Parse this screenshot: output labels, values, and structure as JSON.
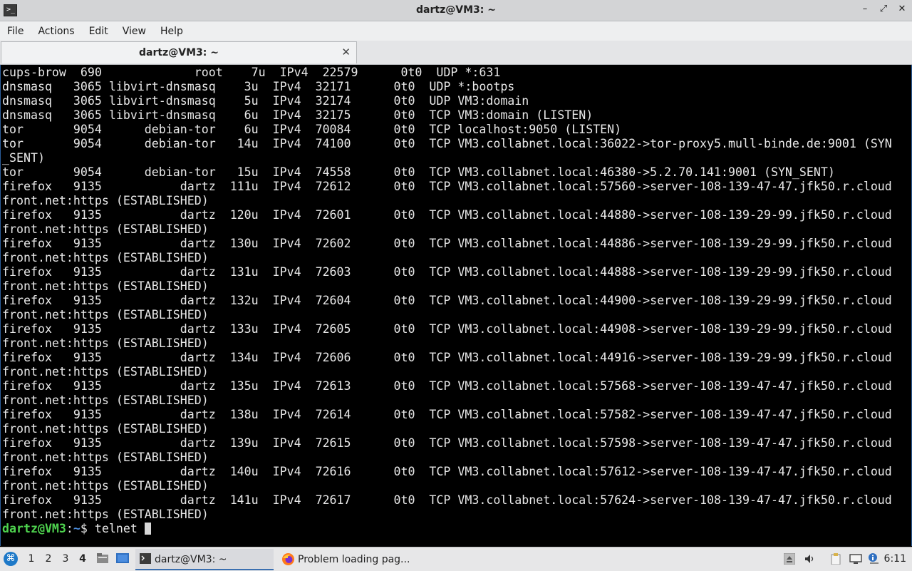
{
  "window": {
    "title": "dartz@VM3: ~",
    "app_icon_glyph": ">_",
    "controls": {
      "minimize": "–",
      "maximize": "⤢",
      "close": "✕"
    }
  },
  "menu": [
    "File",
    "Actions",
    "Edit",
    "View",
    "Help"
  ],
  "tab": {
    "label": "dartz@VM3: ~",
    "close": "✕"
  },
  "terminal": {
    "lines": [
      "cups-brow  690             root    7u  IPv4  22579      0t0  UDP *:631",
      "dnsmasq   3065 libvirt-dnsmasq    3u  IPv4  32171      0t0  UDP *:bootps",
      "dnsmasq   3065 libvirt-dnsmasq    5u  IPv4  32174      0t0  UDP VM3:domain",
      "dnsmasq   3065 libvirt-dnsmasq    6u  IPv4  32175      0t0  TCP VM3:domain (LISTEN)",
      "tor       9054      debian-tor    6u  IPv4  70084      0t0  TCP localhost:9050 (LISTEN)",
      "tor       9054      debian-tor   14u  IPv4  74100      0t0  TCP VM3.collabnet.local:36022->tor-proxy5.mull-binde.de:9001 (SYN",
      "_SENT)",
      "tor       9054      debian-tor   15u  IPv4  74558      0t0  TCP VM3.collabnet.local:46380->5.2.70.141:9001 (SYN_SENT)",
      "firefox   9135           dartz  111u  IPv4  72612      0t0  TCP VM3.collabnet.local:57560->server-108-139-47-47.jfk50.r.cloud",
      "front.net:https (ESTABLISHED)",
      "firefox   9135           dartz  120u  IPv4  72601      0t0  TCP VM3.collabnet.local:44880->server-108-139-29-99.jfk50.r.cloud",
      "front.net:https (ESTABLISHED)",
      "firefox   9135           dartz  130u  IPv4  72602      0t0  TCP VM3.collabnet.local:44886->server-108-139-29-99.jfk50.r.cloud",
      "front.net:https (ESTABLISHED)",
      "firefox   9135           dartz  131u  IPv4  72603      0t0  TCP VM3.collabnet.local:44888->server-108-139-29-99.jfk50.r.cloud",
      "front.net:https (ESTABLISHED)",
      "firefox   9135           dartz  132u  IPv4  72604      0t0  TCP VM3.collabnet.local:44900->server-108-139-29-99.jfk50.r.cloud",
      "front.net:https (ESTABLISHED)",
      "firefox   9135           dartz  133u  IPv4  72605      0t0  TCP VM3.collabnet.local:44908->server-108-139-29-99.jfk50.r.cloud",
      "front.net:https (ESTABLISHED)",
      "firefox   9135           dartz  134u  IPv4  72606      0t0  TCP VM3.collabnet.local:44916->server-108-139-29-99.jfk50.r.cloud",
      "front.net:https (ESTABLISHED)",
      "firefox   9135           dartz  135u  IPv4  72613      0t0  TCP VM3.collabnet.local:57568->server-108-139-47-47.jfk50.r.cloud",
      "front.net:https (ESTABLISHED)",
      "firefox   9135           dartz  138u  IPv4  72614      0t0  TCP VM3.collabnet.local:57582->server-108-139-47-47.jfk50.r.cloud",
      "front.net:https (ESTABLISHED)",
      "firefox   9135           dartz  139u  IPv4  72615      0t0  TCP VM3.collabnet.local:57598->server-108-139-47-47.jfk50.r.cloud",
      "front.net:https (ESTABLISHED)",
      "firefox   9135           dartz  140u  IPv4  72616      0t0  TCP VM3.collabnet.local:57612->server-108-139-47-47.jfk50.r.cloud",
      "front.net:https (ESTABLISHED)",
      "firefox   9135           dartz  141u  IPv4  72617      0t0  TCP VM3.collabnet.local:57624->server-108-139-47-47.jfk50.r.cloud",
      "front.net:https (ESTABLISHED)"
    ],
    "prompt": {
      "user_host": "dartz@VM3",
      "sep": ":",
      "path": "~",
      "symbol": "$",
      "command": " telnet "
    }
  },
  "taskbar": {
    "workspaces": [
      "1",
      "2",
      "3",
      "4"
    ],
    "active_workspace": "4",
    "tasks": [
      {
        "label": "dartz@VM3: ~",
        "icon": "terminal-icon"
      },
      {
        "label": "Problem loading pag...",
        "icon": "firefox-icon"
      }
    ],
    "clock": "6:11"
  },
  "colors": {
    "prompt_user": "#4ed34e",
    "prompt_path": "#4c8fe0",
    "terminal_bg": "#000000",
    "terminal_fg": "#e8e8e8"
  }
}
